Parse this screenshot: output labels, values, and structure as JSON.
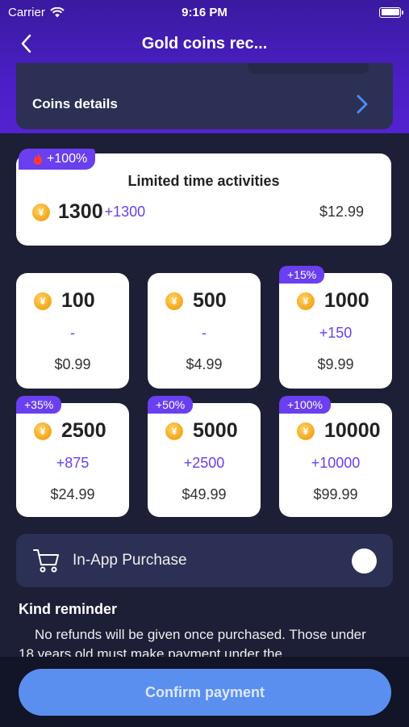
{
  "status_bar": {
    "carrier": "Carrier",
    "time": "9:16 PM"
  },
  "nav": {
    "title": "Gold coins rec...",
    "back_icon": "chevron-left-icon"
  },
  "coins_details": {
    "label": "Coins details",
    "icon": "chevron-right-icon"
  },
  "promo": {
    "badge": "+100%",
    "title": "Limited time activities",
    "coins": "1300",
    "bonus": "+1300",
    "price": "$12.99"
  },
  "packages": [
    {
      "badge": "",
      "coins": "100",
      "bonus": "-",
      "price": "$0.99"
    },
    {
      "badge": "",
      "coins": "500",
      "bonus": "-",
      "price": "$4.99"
    },
    {
      "badge": "+15%",
      "coins": "1000",
      "bonus": "+150",
      "price": "$9.99"
    },
    {
      "badge": "+35%",
      "coins": "2500",
      "bonus": "+875",
      "price": "$24.99"
    },
    {
      "badge": "+50%",
      "coins": "5000",
      "bonus": "+2500",
      "price": "$49.99"
    },
    {
      "badge": "+100%",
      "coins": "10000",
      "bonus": "+10000",
      "price": "$99.99"
    }
  ],
  "coin_symbol": "¥",
  "payment": {
    "label": "In-App Purchase",
    "icon": "shopping-cart-icon"
  },
  "reminder": {
    "title": "Kind reminder",
    "text": "No refunds will be given once purchased. Those under 18 years old must make payment under the"
  },
  "confirm_label": "Confirm payment",
  "colors": {
    "header": "#4a1fc4",
    "accent": "#6a3ff0",
    "button": "#5a8ff0",
    "background": "#1c1f35"
  }
}
